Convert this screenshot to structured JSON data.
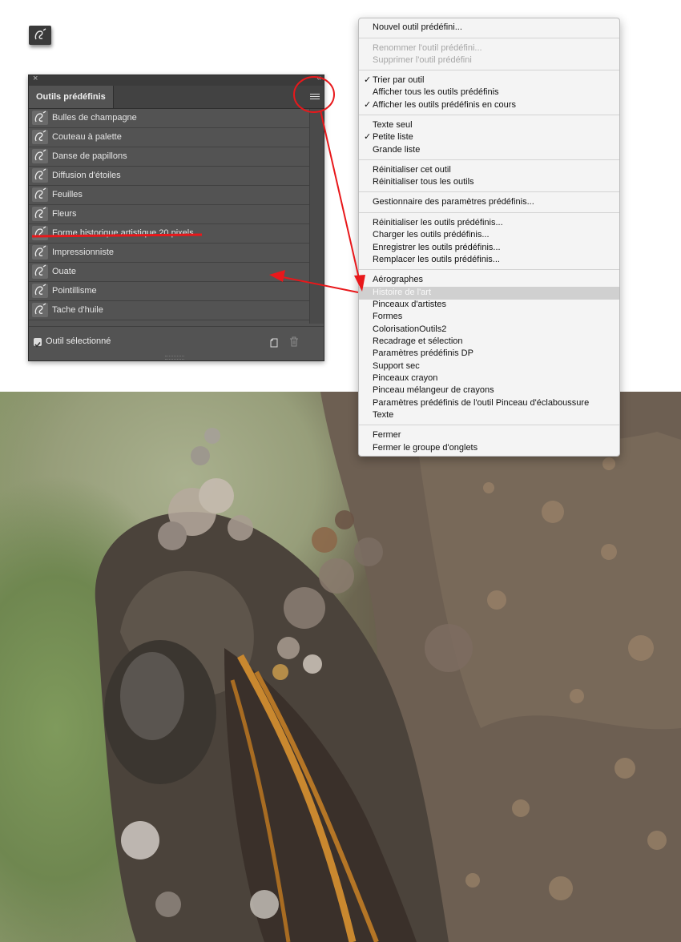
{
  "panel": {
    "tab_title": "Outils prédéfinis",
    "close_glyph": "×",
    "collapse_glyph": "‹‹",
    "items": [
      {
        "label": "Bulles de champagne"
      },
      {
        "label": "Couteau à palette"
      },
      {
        "label": "Danse de papillons"
      },
      {
        "label": "Diffusion d'étoiles"
      },
      {
        "label": "Feuilles"
      },
      {
        "label": "Fleurs"
      },
      {
        "label": "Forme historique artistique 20 pixels"
      },
      {
        "label": "Impressionniste"
      },
      {
        "label": "Ouate"
      },
      {
        "label": "Pointillisme"
      },
      {
        "label": "Tache d'huile"
      }
    ],
    "footer_checkbox_label": "Outil sélectionné",
    "footer_checkbox_checked": true
  },
  "menu": {
    "items": [
      {
        "label": "Nouvel outil prédéfini..."
      },
      {
        "label": "Renommer l'outil prédéfini...",
        "disabled": true
      },
      {
        "label": "Supprimer l'outil prédéfini",
        "disabled": true
      },
      {
        "label": "Trier par outil",
        "checked": true
      },
      {
        "label": "Afficher tous les outils prédéfinis"
      },
      {
        "label": "Afficher les outils prédéfinis en cours",
        "checked": true
      },
      {
        "label": "Texte seul"
      },
      {
        "label": "Petite liste",
        "checked": true
      },
      {
        "label": "Grande liste"
      },
      {
        "label": "Réinitialiser cet outil"
      },
      {
        "label": "Réinitialiser tous les outils"
      },
      {
        "label": "Gestionnaire des paramètres prédéfinis..."
      },
      {
        "label": "Réinitialiser les outils prédéfinis..."
      },
      {
        "label": "Charger les outils prédéfinis..."
      },
      {
        "label": "Enregistrer les outils prédéfinis..."
      },
      {
        "label": "Remplacer les outils prédéfinis..."
      },
      {
        "label": "Aérographes"
      },
      {
        "label": "Histoire de l'art",
        "highlighted": true
      },
      {
        "label": "Pinceaux d'artistes"
      },
      {
        "label": "Formes"
      },
      {
        "label": "ColorisationOutils2"
      },
      {
        "label": "Recadrage et sélection"
      },
      {
        "label": "Paramètres prédéfinis DP"
      },
      {
        "label": "Support sec"
      },
      {
        "label": "Pinceaux crayon"
      },
      {
        "label": "Pinceau mélangeur de crayons"
      },
      {
        "label": "Paramètres prédéfinis de l'outil Pinceau d'éclaboussure"
      },
      {
        "label": "Texte"
      },
      {
        "label": "Fermer"
      },
      {
        "label": "Fermer le groupe d'onglets"
      }
    ],
    "check_glyph": "✓"
  },
  "colors": {
    "panel_bg": "#535353",
    "menu_bg": "#f4f4f4",
    "highlight_bg": "#d0d0d0",
    "annotation_red": "#e8181b"
  },
  "icons": {
    "tool_preset": "history-brush-icon",
    "panel_menu": "hamburger-icon",
    "new_preset": "new-preset-icon",
    "trash": "trash-icon"
  }
}
